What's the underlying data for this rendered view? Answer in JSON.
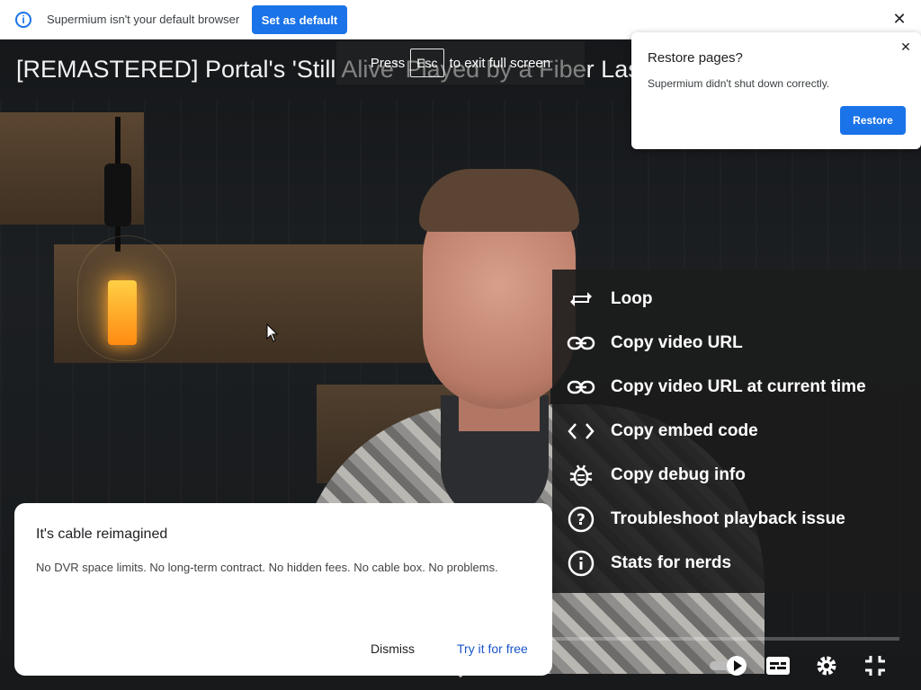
{
  "infobar": {
    "message": "Supermium isn't your default browser",
    "set_default_label": "Set as default",
    "info_icon": "info-icon",
    "close_icon": "close-icon"
  },
  "video": {
    "title": "[REMASTERED] Portal's 'Still Alive' Played by a Fiber Laser"
  },
  "fullscreen_hint": {
    "press": "Press",
    "key": "Esc",
    "rest": "to exit full screen"
  },
  "restore_popup": {
    "title": "Restore pages?",
    "message": "Supermium didn't shut down correctly.",
    "button_label": "Restore"
  },
  "context_menu": {
    "items": [
      {
        "label": "Loop",
        "icon": "loop-icon"
      },
      {
        "label": "Copy video URL",
        "icon": "link-icon"
      },
      {
        "label": "Copy video URL at current time",
        "icon": "link-icon"
      },
      {
        "label": "Copy embed code",
        "icon": "code-icon"
      },
      {
        "label": "Copy debug info",
        "icon": "bug-icon"
      },
      {
        "label": "Troubleshoot playback issue",
        "icon": "help-icon"
      },
      {
        "label": "Stats for nerds",
        "icon": "info-icon"
      }
    ]
  },
  "ad_card": {
    "title": "It's cable reimagined",
    "body": "No DVR space limits. No long-term contract. No hidden fees. No cable box. No problems.",
    "dismiss_label": "Dismiss",
    "cta_label": "Try it for free"
  },
  "controls": {
    "autoplay_icon": "autoplay-toggle-icon",
    "subtitles_icon": "subtitles-icon",
    "settings_icon": "gear-icon",
    "exit_fullscreen_icon": "exit-fullscreen-icon"
  },
  "colors": {
    "accent": "#1a73e8",
    "menu_bg": "#1c1c1c"
  }
}
